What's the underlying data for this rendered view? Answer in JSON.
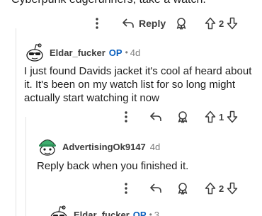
{
  "top_comment": {
    "text_fragment": "Cyberpunk edgerunners, take a watch.",
    "actions": {
      "more_label": "more-options",
      "reply_label": "Reply",
      "vote_count": "2"
    }
  },
  "comments": [
    {
      "username": "Eldar_fucker",
      "op_badge": "OP",
      "separator": "•",
      "age": "4d",
      "body": "I just found Davids jacket it's cool af heard about it. It's been on my watch list for so long might actually start watching it now",
      "vote_count": "1"
    },
    {
      "username": "AdvertisingOk9147",
      "age": "4d",
      "body": "Reply back when you finished it.",
      "vote_count": "2"
    },
    {
      "username": "Eldar_fucker",
      "op_badge": "OP",
      "separator": "•",
      "age": "3"
    }
  ],
  "colors": {
    "op_blue": "#0a5fbe",
    "meta_gray": "#7c7c7c",
    "icon_gray": "#3c3c3c",
    "thread_line": "#e3e3e3"
  },
  "icons": [
    "more-vertical-icon",
    "reply-arrow-icon",
    "award-icon",
    "upvote-icon",
    "downvote-icon",
    "snoo-sunglasses-avatar",
    "snoo-green-hat-avatar"
  ]
}
